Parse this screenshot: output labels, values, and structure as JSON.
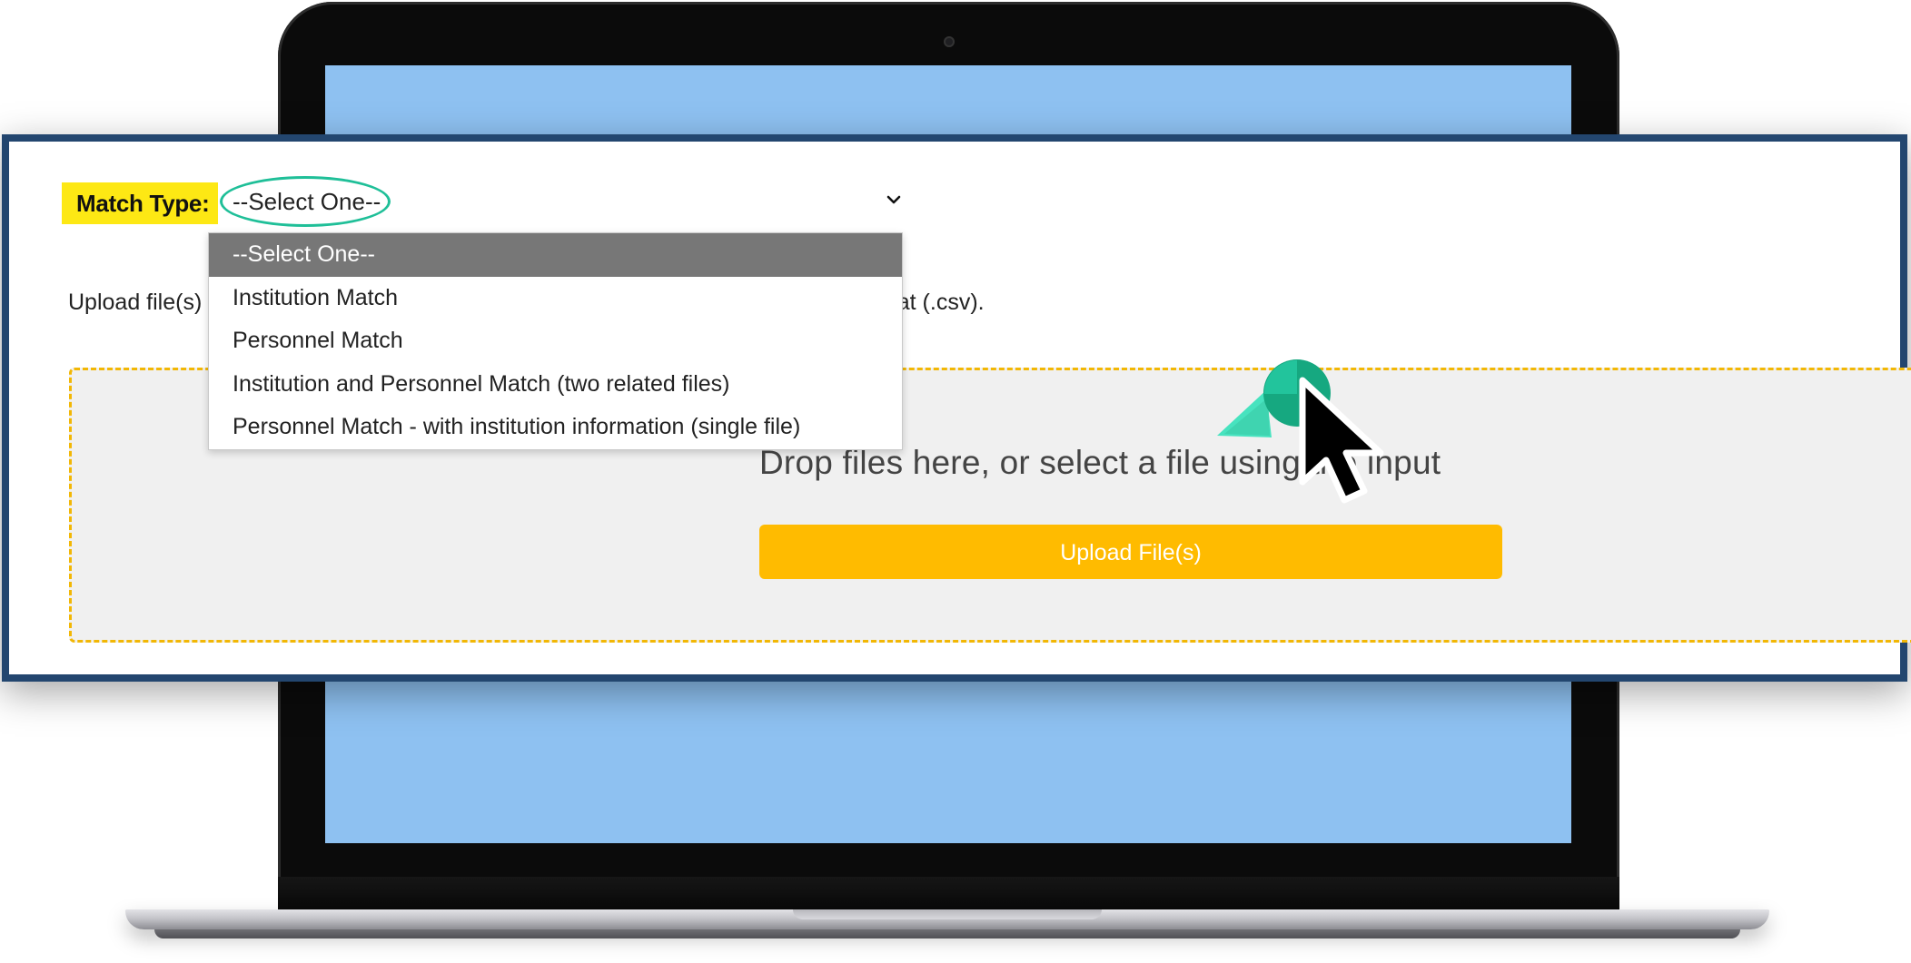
{
  "form": {
    "match_type_label": "Match Type:",
    "select_value": "--Select One--",
    "upload_instructions_left": "Upload file(s)",
    "upload_instructions_right": "ed value format (.csv)."
  },
  "dropdown": {
    "options": [
      {
        "label": "--Select One--"
      },
      {
        "label": "Institution Match"
      },
      {
        "label": "Personnel Match"
      },
      {
        "label": "Institution and Personnel Match (two related files)"
      },
      {
        "label": "Personnel Match - with institution information (single file)"
      }
    ],
    "selected_index": 0
  },
  "dropzone": {
    "prompt": "Drop files here, or select a file using the input",
    "button_label": "Upload File(s)"
  },
  "colors": {
    "label_highlight": "#fde814",
    "annotation_ring": "#1fbf98",
    "panel_border": "#23466f",
    "dropzone_border": "#f2b705",
    "button": "#ffbb00",
    "laptop_screen": "#8ec1f1",
    "selected_option": "#777777"
  },
  "icons": {
    "select_chevron": "chevron-down-icon",
    "click": "click-indicator-icon",
    "cursor": "mouse-pointer-icon"
  }
}
